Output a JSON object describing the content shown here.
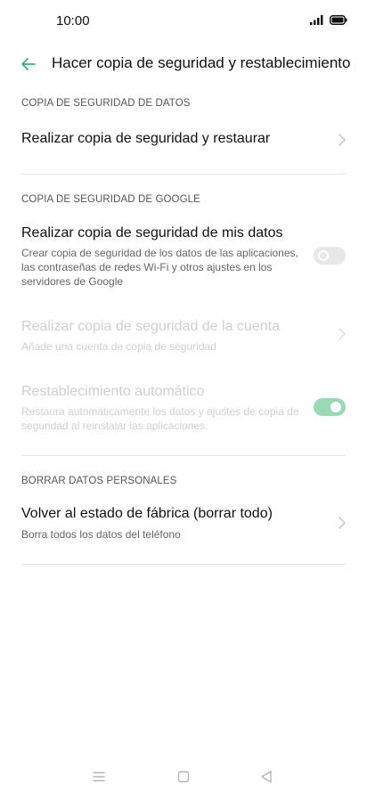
{
  "status_bar": {
    "time": "10:00"
  },
  "header": {
    "title": "Hacer copia de seguridad y restablecimiento"
  },
  "sections": {
    "data_backup": {
      "label": "COPIA DE SEGURIDAD DE DATOS",
      "backup_restore": {
        "title": "Realizar copia de seguridad y restaurar"
      }
    },
    "google_backup": {
      "label": "COPIA DE SEGURIDAD DE GOOGLE",
      "backup_my_data": {
        "title": "Realizar copia de seguridad de mis datos",
        "subtitle": "Crear copia de seguridad de los datos de las aplicaciones, las contraseñas de redes Wi-Fi y otros ajustes en los servidores de Google",
        "toggle_on": false
      },
      "backup_account": {
        "title": "Realizar copia de seguridad de la cuenta",
        "subtitle": "Añade una cuenta de copia de seguridad"
      },
      "auto_restore": {
        "title": "Restablecimiento automático",
        "subtitle": "Restaura automáticamente los datos y ajustes de copia de seguridad al reinstalar las aplicaciones.",
        "toggle_on": true
      }
    },
    "personal_data": {
      "label": "BORRAR DATOS PERSONALES",
      "factory_reset": {
        "title": "Volver al estado de fábrica (borrar todo)",
        "subtitle": "Borra todos los datos del teléfono"
      }
    }
  },
  "colors": {
    "accent": "#2eb872",
    "toggle_on": "#9ad9b6",
    "disabled_text": "#cfcfcf"
  },
  "icons": {
    "back": "arrow-left-icon",
    "chevron": "chevron-right-icon",
    "nav_menu": "menu-icon",
    "nav_home": "square-icon",
    "nav_back": "triangle-back-icon"
  }
}
